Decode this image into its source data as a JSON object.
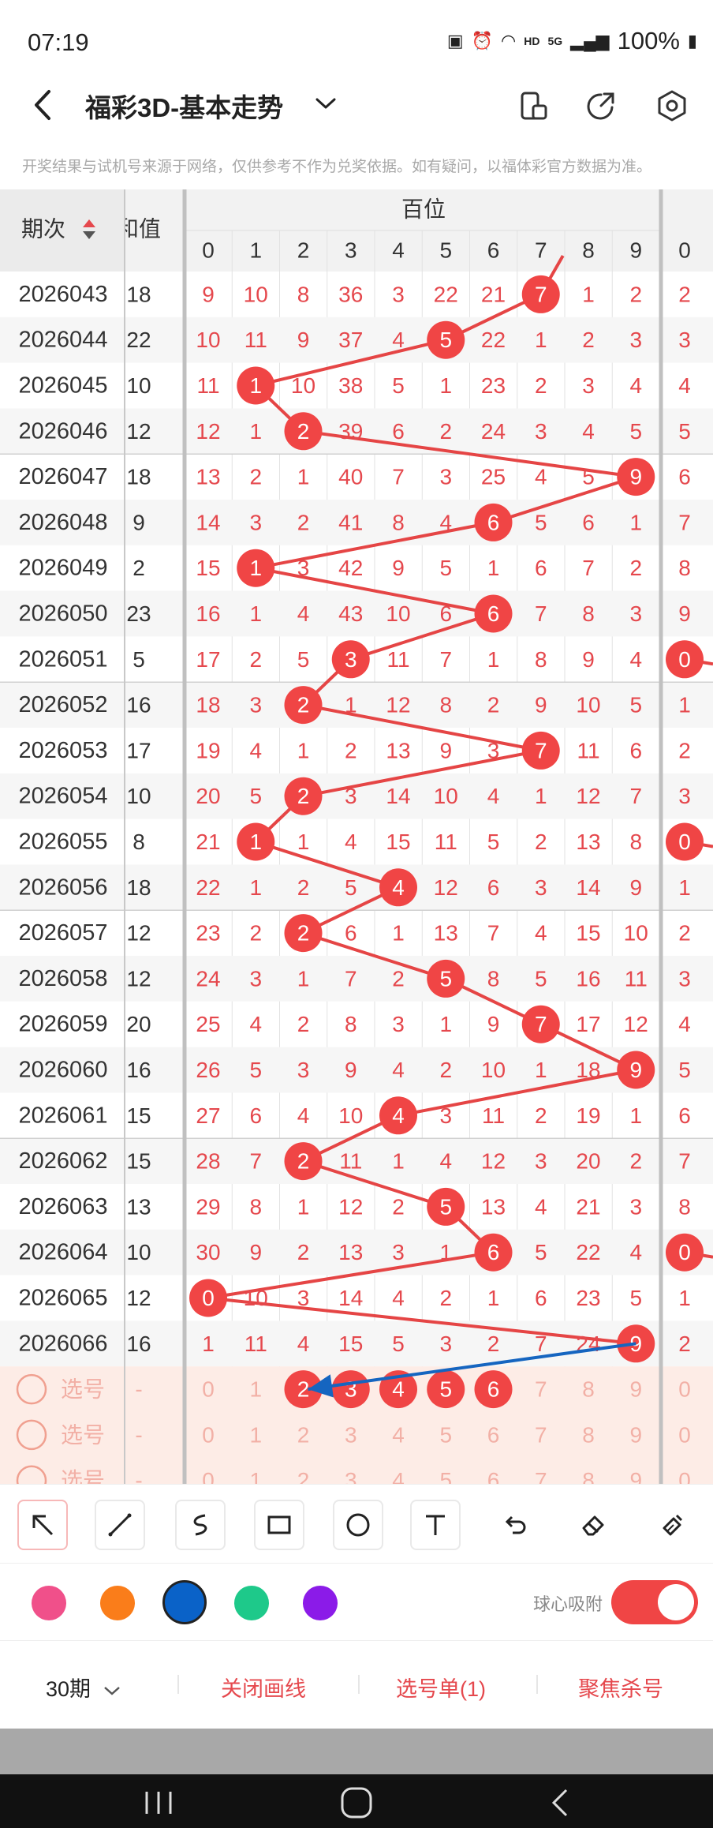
{
  "status_bar": {
    "time": "07:19",
    "network": "HD",
    "signal_type": "5G",
    "battery": "100%"
  },
  "header": {
    "title": "福彩3D-基本走势",
    "notice": "开奖结果与试机号来源于网络，仅供参考不作为兑奖依据。如有疑问，以福体彩官方数据为准。"
  },
  "table": {
    "col_issue": "期次",
    "col_sum": "和值",
    "group_label": "百位",
    "digits": [
      "0",
      "1",
      "2",
      "3",
      "4",
      "5",
      "6",
      "7",
      "8",
      "9"
    ],
    "next_group_first": "0",
    "rows": [
      {
        "issue": "2026043",
        "sum": "18",
        "cells": [
          "9",
          "10",
          "8",
          "36",
          "3",
          "22",
          "21",
          "7",
          "1",
          "2"
        ],
        "hit": 7,
        "next": "2"
      },
      {
        "issue": "2026044",
        "sum": "22",
        "cells": [
          "10",
          "11",
          "9",
          "37",
          "4",
          "5",
          "22",
          "1",
          "2",
          "3"
        ],
        "hit": 5,
        "next": "3"
      },
      {
        "issue": "2026045",
        "sum": "10",
        "cells": [
          "11",
          "1",
          "10",
          "38",
          "5",
          "1",
          "23",
          "2",
          "3",
          "4"
        ],
        "hit": 1,
        "next": "4"
      },
      {
        "issue": "2026046",
        "sum": "12",
        "cells": [
          "12",
          "1",
          "2",
          "39",
          "6",
          "2",
          "24",
          "3",
          "4",
          "5"
        ],
        "hit": 2,
        "next": "5"
      },
      {
        "issue": "2026047",
        "sum": "18",
        "cells": [
          "13",
          "2",
          "1",
          "40",
          "7",
          "3",
          "25",
          "4",
          "5",
          "9"
        ],
        "hit": 9,
        "next": "6"
      },
      {
        "issue": "2026048",
        "sum": "9",
        "cells": [
          "14",
          "3",
          "2",
          "41",
          "8",
          "4",
          "6",
          "5",
          "6",
          "1"
        ],
        "hit": 6,
        "next": "7"
      },
      {
        "issue": "2026049",
        "sum": "2",
        "cells": [
          "15",
          "1",
          "3",
          "42",
          "9",
          "5",
          "1",
          "6",
          "7",
          "2"
        ],
        "hit": 1,
        "next": "8"
      },
      {
        "issue": "2026050",
        "sum": "23",
        "cells": [
          "16",
          "1",
          "4",
          "43",
          "10",
          "6",
          "6",
          "7",
          "8",
          "3"
        ],
        "hit": 6,
        "next": "9"
      },
      {
        "issue": "2026051",
        "sum": "5",
        "cells": [
          "17",
          "2",
          "5",
          "3",
          "11",
          "7",
          "1",
          "8",
          "9",
          "4"
        ],
        "hit": 3,
        "next": "0"
      },
      {
        "issue": "2026052",
        "sum": "16",
        "cells": [
          "18",
          "3",
          "2",
          "1",
          "12",
          "8",
          "2",
          "9",
          "10",
          "5"
        ],
        "hit": 2,
        "next": "1"
      },
      {
        "issue": "2026053",
        "sum": "17",
        "cells": [
          "19",
          "4",
          "1",
          "2",
          "13",
          "9",
          "3",
          "7",
          "11",
          "6"
        ],
        "hit": 7,
        "next": "2"
      },
      {
        "issue": "2026054",
        "sum": "10",
        "cells": [
          "20",
          "5",
          "2",
          "3",
          "14",
          "10",
          "4",
          "1",
          "12",
          "7"
        ],
        "hit": 2,
        "next": "3"
      },
      {
        "issue": "2026055",
        "sum": "8",
        "cells": [
          "21",
          "1",
          "1",
          "4",
          "15",
          "11",
          "5",
          "2",
          "13",
          "8"
        ],
        "hit": 1,
        "next": "0"
      },
      {
        "issue": "2026056",
        "sum": "18",
        "cells": [
          "22",
          "1",
          "2",
          "5",
          "4",
          "12",
          "6",
          "3",
          "14",
          "9"
        ],
        "hit": 4,
        "next": "1"
      },
      {
        "issue": "2026057",
        "sum": "12",
        "cells": [
          "23",
          "2",
          "2",
          "6",
          "1",
          "13",
          "7",
          "4",
          "15",
          "10"
        ],
        "hit": 2,
        "next": "2"
      },
      {
        "issue": "2026058",
        "sum": "12",
        "cells": [
          "24",
          "3",
          "1",
          "7",
          "2",
          "5",
          "8",
          "5",
          "16",
          "11"
        ],
        "hit": 5,
        "next": "3"
      },
      {
        "issue": "2026059",
        "sum": "20",
        "cells": [
          "25",
          "4",
          "2",
          "8",
          "3",
          "1",
          "9",
          "7",
          "17",
          "12"
        ],
        "hit": 7,
        "next": "4"
      },
      {
        "issue": "2026060",
        "sum": "16",
        "cells": [
          "26",
          "5",
          "3",
          "9",
          "4",
          "2",
          "10",
          "1",
          "18",
          "9"
        ],
        "hit": 9,
        "next": "5"
      },
      {
        "issue": "2026061",
        "sum": "15",
        "cells": [
          "27",
          "6",
          "4",
          "10",
          "4",
          "3",
          "11",
          "2",
          "19",
          "1"
        ],
        "hit": 4,
        "next": "6"
      },
      {
        "issue": "2026062",
        "sum": "15",
        "cells": [
          "28",
          "7",
          "2",
          "11",
          "1",
          "4",
          "12",
          "3",
          "20",
          "2"
        ],
        "hit": 2,
        "next": "7"
      },
      {
        "issue": "2026063",
        "sum": "13",
        "cells": [
          "29",
          "8",
          "1",
          "12",
          "2",
          "5",
          "13",
          "4",
          "21",
          "3"
        ],
        "hit": 5,
        "next": "8"
      },
      {
        "issue": "2026064",
        "sum": "10",
        "cells": [
          "30",
          "9",
          "2",
          "13",
          "3",
          "1",
          "6",
          "5",
          "22",
          "4"
        ],
        "hit": 6,
        "next": "0"
      },
      {
        "issue": "2026065",
        "sum": "12",
        "cells": [
          "0",
          "10",
          "3",
          "14",
          "4",
          "2",
          "1",
          "6",
          "23",
          "5"
        ],
        "hit": 0,
        "next": "1"
      },
      {
        "issue": "2026066",
        "sum": "16",
        "cells": [
          "1",
          "11",
          "4",
          "15",
          "5",
          "3",
          "2",
          "7",
          "24",
          "9"
        ],
        "hit": 9,
        "next": "2"
      }
    ],
    "pick_rows": [
      {
        "label": "选号",
        "sum": "-",
        "selected": [
          2,
          3,
          4,
          5,
          6
        ],
        "next": "0"
      },
      {
        "label": "选号",
        "sum": "-",
        "selected": [],
        "next": "0"
      },
      {
        "label": "选号",
        "sum": "-",
        "selected": [],
        "next": "0"
      }
    ]
  },
  "drawing": {
    "tools": [
      "pointer",
      "line",
      "curve",
      "rectangle",
      "ellipse",
      "text",
      "undo",
      "eraser",
      "clear"
    ],
    "colors": [
      "#f0508a",
      "#fa7d1a",
      "#0a62c8",
      "#1ec98a",
      "#8b1be8"
    ],
    "selected_color": "#0a62c8",
    "magnet_label": "球心吸附",
    "magnet_on": true
  },
  "bottom": {
    "period": "30期",
    "close_drawing": "关闭画线",
    "pick_list": "选号单(1)",
    "focus_kill": "聚焦杀号"
  },
  "colors": {
    "accent": "#f04545",
    "number_text": "#e5484d",
    "row_alt": "#f6f6f6",
    "pick_bg": "#fdece6",
    "pick_text": "#f2b0a6",
    "arrow": "#1565c0"
  }
}
